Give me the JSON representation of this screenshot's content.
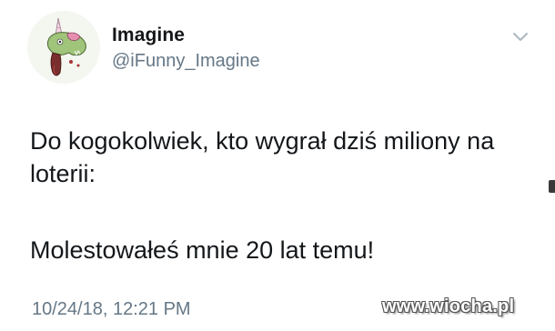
{
  "tweet": {
    "author": {
      "display_name": "Imagine",
      "handle": "@iFunny_Imagine",
      "avatar_icon": "unicorn-zombie-avatar-icon"
    },
    "menu_icon": "chevron-down-icon",
    "text": {
      "paragraph1": "Do kogokolwiek, kto wygrał dziś miliony na loterii:",
      "paragraph2": "Molestowałeś mnie 20 lat temu!"
    },
    "timestamp": "10/24/18, 12:21 PM"
  },
  "watermark": {
    "text": "www.wiocha.pl"
  },
  "colors": {
    "primary_text": "#14171a",
    "secondary_text": "#657786",
    "background": "#ffffff"
  }
}
